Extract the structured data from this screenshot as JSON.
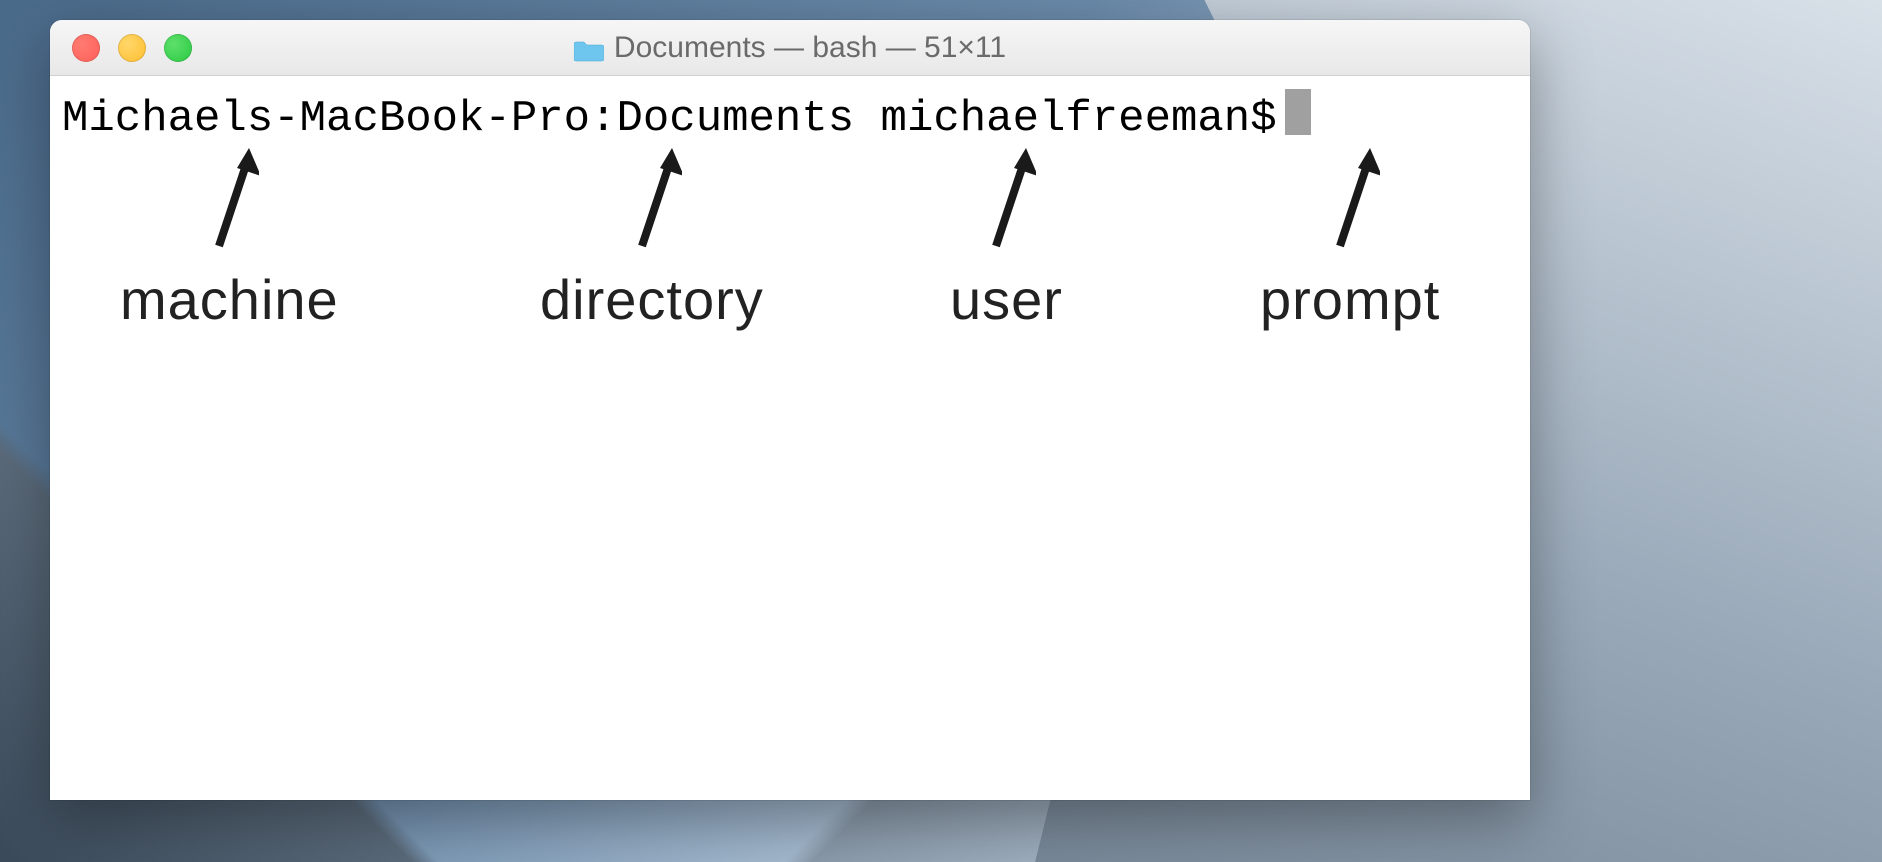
{
  "window": {
    "title": "Documents — bash — 51×11"
  },
  "prompt": {
    "machine": "Michaels-MacBook-Pro",
    "separator1": ":",
    "directory": "Documents",
    "user": "michaelfreeman",
    "symbol": "$"
  },
  "annotations": {
    "machine": "machine",
    "directory": "directory",
    "user": "user",
    "prompt": "prompt"
  }
}
